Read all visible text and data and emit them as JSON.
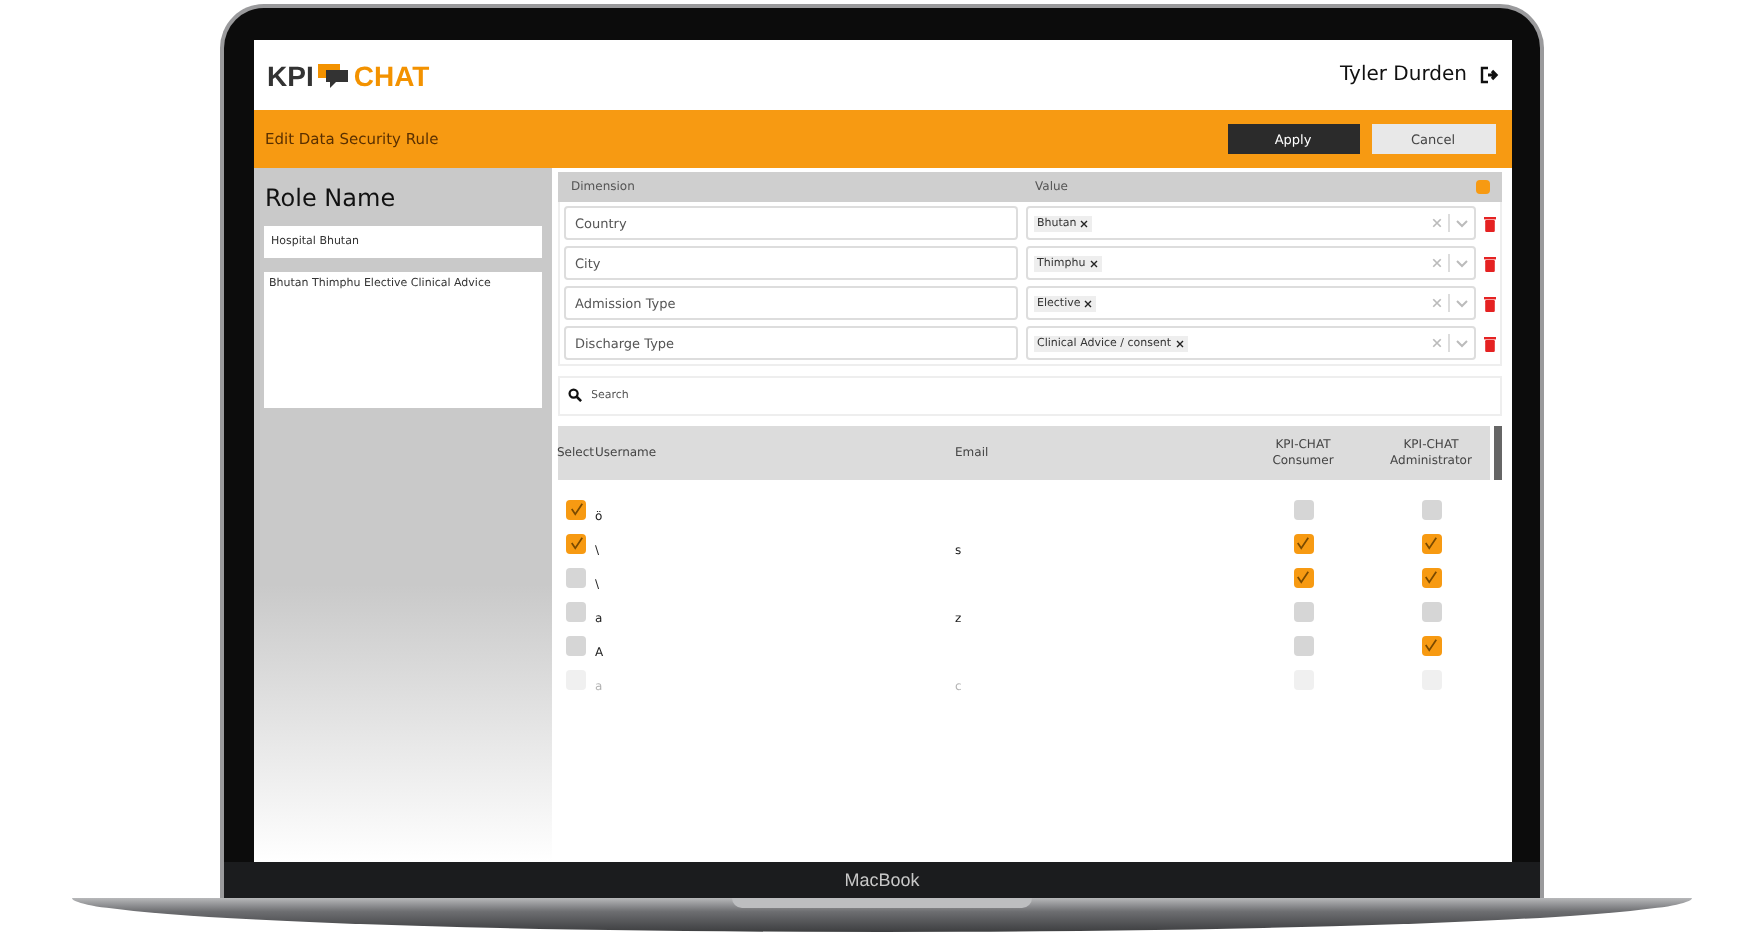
{
  "device": {
    "label": "MacBook"
  },
  "header": {
    "logo_left": "KPI",
    "logo_right": "CHAT",
    "user": "Tyler Durden"
  },
  "toolbar": {
    "title": "Edit Data Security Rule",
    "buttons": [
      {
        "label": "Apply",
        "kind": "primary"
      },
      {
        "label": "Cancel",
        "kind": "secondary"
      }
    ]
  },
  "role": {
    "heading": "Role Name",
    "name": "Hospital Bhutan",
    "description": "Bhutan Thimphu Elective Clinical Advice"
  },
  "rules": {
    "columns": [
      "Dimension",
      "Value"
    ],
    "rows": [
      {
        "dimension": "Country",
        "values": [
          "Bhutan"
        ]
      },
      {
        "dimension": "City",
        "values": [
          "Thimphu"
        ]
      },
      {
        "dimension": "Admission Type",
        "values": [
          "Elective"
        ]
      },
      {
        "dimension": "Discharge Type",
        "values": [
          "Clinical Advice / consent"
        ]
      }
    ]
  },
  "search": {
    "placeholder": "Search"
  },
  "users": {
    "columns": [
      "Select",
      "Username",
      "Email",
      "KPI-CHAT Consumer",
      "KPI-CHAT Administrator"
    ],
    "rows": [
      {
        "selected": true,
        "username": "ö",
        "consumer": false,
        "administrator": false,
        "faded": false
      },
      {
        "selected": true,
        "username": "\\",
        "email": "s",
        "consumer": true,
        "administrator": true,
        "faded": false
      },
      {
        "selected": false,
        "username": "\\",
        "consumer": true,
        "administrator": true,
        "faded": false
      },
      {
        "selected": false,
        "username": "a",
        "email": "z",
        "consumer": false,
        "administrator": false,
        "faded": false
      },
      {
        "selected": false,
        "username": "A",
        "consumer": false,
        "administrator": true,
        "faded": false
      },
      {
        "selected": false,
        "username": "a",
        "email": "c",
        "consumer": false,
        "administrator": false,
        "faded": true
      }
    ]
  }
}
